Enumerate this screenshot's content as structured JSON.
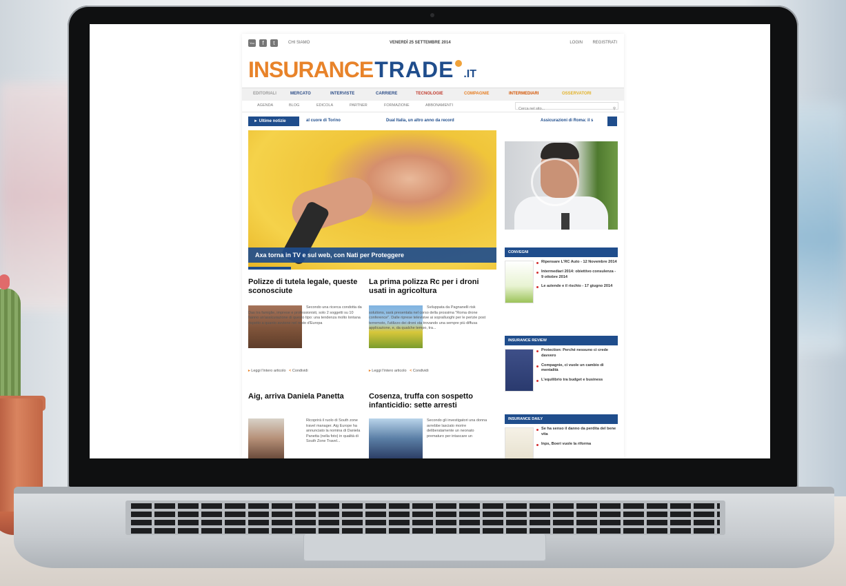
{
  "site": {
    "topbar": {
      "social": [
        "You",
        "f",
        "t"
      ],
      "chi_siamo": "CHI SIAMO",
      "date": "VENERDÌ 25 SETTEMBRE 2014",
      "login": "LOGIN",
      "register": "REGISTRATI"
    },
    "logo": {
      "insurance": "INSURANCE",
      "trade": "TRADE",
      "tld": ".IT"
    },
    "nav_primary": [
      {
        "label": "EDITORIALI",
        "color": "#9b9b9b"
      },
      {
        "label": "MERCATO",
        "color": "#2b4c86"
      },
      {
        "label": "INTERVISTE",
        "color": "#2b4c86"
      },
      {
        "label": "CARRIERE",
        "color": "#2b4c86"
      },
      {
        "label": "TECNOLOGIE",
        "color": "#c0392b"
      },
      {
        "label": "COMPAGNIE",
        "color": "#e67e22"
      },
      {
        "label": "INTERMEDIARI",
        "color": "#d35400"
      },
      {
        "label": "OSSERVATORI",
        "color": "#e2b127"
      }
    ],
    "nav_secondary": [
      "AGENDA",
      "BLOG",
      "EDICOLA",
      "PARTNER",
      "FORMAZIONE",
      "ABBONAMENTI"
    ],
    "search_placeholder": "Cerca nel sito...",
    "ticker": {
      "label": "Ultime notizie",
      "items": [
        "al cuore di Torino",
        "Dual Italia, un altro anno da record",
        "Assicurazioni di Roma: il s"
      ]
    },
    "hero_caption": "Axa torna in TV e sul web, con Nati per Proteggere",
    "articles": [
      {
        "title": "Polizze di tutela legale, queste sconosciute",
        "body": "Secondo una ricerca condotta da Das tra famiglie, imprese e professionisti, solo 2 soggetti su 10 hanno un'assicurazione di questo tipo: una tendenza molto lontana rispetto a quanto avviene nel resto d'Europa",
        "more": "Leggi l'intero articolo",
        "share": "Condividi"
      },
      {
        "title": "La prima polizza Rc per i droni usati in agricoltura",
        "body": "Sviluppata da Pagnanelli risk solutions, sarà presentata nel corso della prossima \"Roma drone conference\". Dalle riprese televisive ai sopralluoghi per le perizie post terremoto, l'utilizzo dei droni sta trovando una sempre più diffusa applicazione, e, da qualche tempo, tra...",
        "more": "Leggi l'intero articolo",
        "share": "Condividi"
      },
      {
        "title": "Aig, arriva Daniela Panetta",
        "body": "Ricoprirà il ruolo di South zone travel manager. Aig Europe ha annunciato la nomina di Daniela Panetta (nella foto) in qualità di South Zone Travel..."
      },
      {
        "title": "Cosenza, truffa con sospetto infanticidio: sette arresti",
        "body": "Secondo gli investigatori una donna avrebbe lasciato morire deliberatamente un neonato prematuro per intascare un"
      }
    ],
    "sidebar": {
      "convegni": {
        "title": "CONVEGNI",
        "items": [
          "Ripensare L'RC Auto - 12 Novembre 2014",
          "Intermediari 2014: obiettivo consulenza - 9 ottobre 2014",
          "Le aziende e il rischio - 17 giugno 2014"
        ]
      },
      "review": {
        "title": "INSURANCE REVIEW",
        "items": [
          "Protection: Perché nessuno ci crede davvero",
          "Compagnie, ci vuole un cambio di mentalità",
          "L'equilibrio tra budget e business"
        ]
      },
      "daily": {
        "title": "INSURANCE DAILY",
        "items": [
          "Se ha senso il danno da perdita del bene vita",
          "Inps, Boeri vuole la riforma"
        ]
      }
    }
  }
}
